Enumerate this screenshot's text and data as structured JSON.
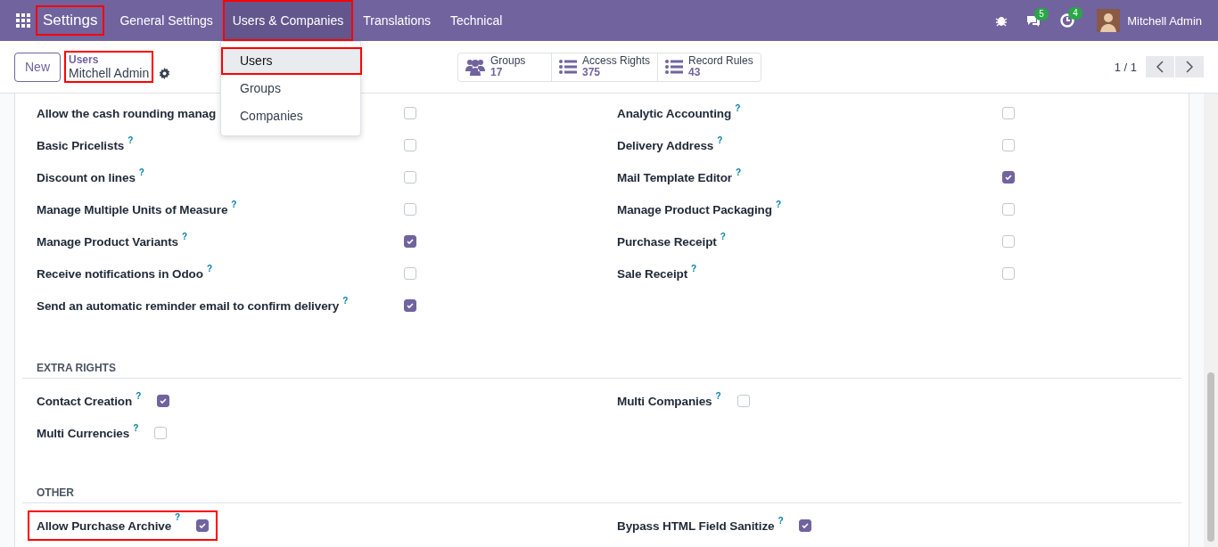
{
  "navbar": {
    "app": {
      "label": "Settings",
      "highlighted": true
    },
    "menus": [
      {
        "label": "General Settings",
        "selected": false,
        "highlighted": false
      },
      {
        "label": "Users & Companies",
        "selected": true,
        "highlighted": true
      },
      {
        "label": "Translations",
        "selected": false,
        "highlighted": false
      },
      {
        "label": "Technical",
        "selected": false,
        "highlighted": false
      }
    ],
    "chat_badge": "5",
    "activity_badge": "4",
    "user": "Mitchell Admin"
  },
  "dropdown": {
    "items": [
      {
        "label": "Users",
        "selected": true,
        "highlighted": true
      },
      {
        "label": "Groups",
        "selected": false,
        "highlighted": false
      },
      {
        "label": "Companies",
        "selected": false,
        "highlighted": false
      }
    ]
  },
  "control_panel": {
    "new_button": "New",
    "breadcrumb": {
      "parent": "Users",
      "current": "Mitchell Admin",
      "highlighted": true
    },
    "smart_buttons": [
      {
        "kind": "groups",
        "label": "Groups",
        "count": "17"
      },
      {
        "kind": "list",
        "label": "Access Rights",
        "count": "375"
      },
      {
        "kind": "list",
        "label": "Record Rules",
        "count": "43"
      }
    ],
    "pager": "1 / 1"
  },
  "sections": [
    {
      "kind": "wide",
      "columns": [
        [
          {
            "label": "Allow the cash rounding manag",
            "checked": false,
            "highlighted": false
          },
          {
            "label": "Basic Pricelists",
            "help": "?",
            "checked": false,
            "highlighted": false
          },
          {
            "label": "Discount on lines",
            "help": "?",
            "checked": false,
            "highlighted": false
          },
          {
            "label": "Manage Multiple Units of Measure",
            "help": "?",
            "checked": false,
            "highlighted": false
          },
          {
            "label": "Manage Product Variants",
            "help": "?",
            "checked": true,
            "highlighted": false
          },
          {
            "label": "Receive notifications in Odoo",
            "help": "?",
            "checked": false,
            "highlighted": false
          },
          {
            "label": "Send an automatic reminder email to confirm delivery",
            "help": "?",
            "checked": true,
            "highlighted": false
          }
        ],
        [
          {
            "label": "Analytic Accounting",
            "help": "?",
            "checked": false,
            "highlighted": false
          },
          {
            "label": "Delivery Address",
            "help": "?",
            "checked": false,
            "highlighted": false
          },
          {
            "label": "Mail Template Editor",
            "help": "?",
            "checked": true,
            "highlighted": false
          },
          {
            "label": "Manage Product Packaging",
            "help": "?",
            "checked": false,
            "highlighted": false
          },
          {
            "label": "Purchase Receipt",
            "help": "?",
            "checked": false,
            "highlighted": false
          },
          {
            "label": "Sale Receipt",
            "help": "?",
            "checked": false,
            "highlighted": false
          }
        ]
      ]
    },
    {
      "title": "EXTRA RIGHTS",
      "kind": "compact",
      "columns": [
        [
          {
            "label": "Contact Creation",
            "help": "?",
            "checked": true,
            "highlighted": false
          },
          {
            "label": "Multi Currencies",
            "help": "?",
            "checked": false,
            "highlighted": false
          }
        ],
        [
          {
            "label": "Multi Companies",
            "help": "?",
            "checked": false,
            "highlighted": false
          }
        ]
      ]
    },
    {
      "title": "OTHER",
      "kind": "compact",
      "columns": [
        [
          {
            "label": "Allow Purchase Archive",
            "help": "?",
            "checked": true,
            "highlighted": true
          }
        ],
        [
          {
            "label": "Bypass HTML Field Sanitize",
            "help": "?",
            "checked": true,
            "highlighted": false
          }
        ]
      ]
    }
  ]
}
